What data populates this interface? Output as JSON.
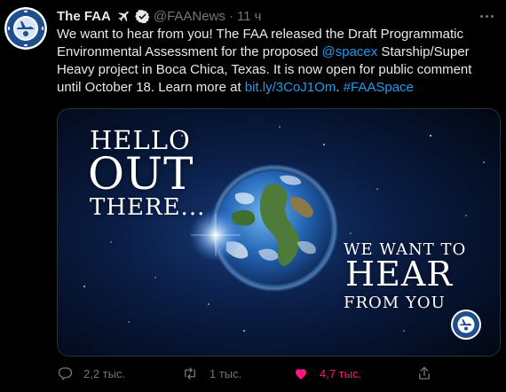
{
  "tweet": {
    "display_name": "The FAA",
    "handle": "@FAANews",
    "separator": "·",
    "time": "11 ч",
    "text_parts": {
      "p1": "We want to hear from you! The FAA released the Draft Programmatic Environmental Assessment for the proposed ",
      "mention": "@spacex",
      "p2": " Starship/Super Heavy project in Boca Chica, Texas. It is now open for public comment until October 18. Learn more at ",
      "link": "bit.ly/3CoJ1Om",
      "p3": ". ",
      "hashtag": "#FAASpace"
    },
    "media": {
      "hello_line1": "HELLO",
      "hello_line2": "OUT",
      "hello_line3": "THERE...",
      "want_line1": "WE WANT TO",
      "want_line2": "HEAR",
      "want_line3": "FROM YOU"
    },
    "actions": {
      "replies": "2,2 тыс.",
      "retweets": "1 тыс.",
      "likes": "4,7 тыс."
    }
  },
  "colors": {
    "background": "#000000",
    "text": "#e7e9ea",
    "secondary": "#71767b",
    "link": "#1d9bf0",
    "like": "#f91880",
    "verified": "#e7e9ea",
    "seal_blue": "#1f4e8c"
  },
  "icons": {
    "avatar": "faa-seal-icon",
    "plane": "airplane-icon",
    "verified": "verified-badge-icon",
    "more": "more-icon",
    "reply": "reply-icon",
    "retweet": "retweet-icon",
    "like": "heart-icon",
    "share": "share-icon"
  }
}
